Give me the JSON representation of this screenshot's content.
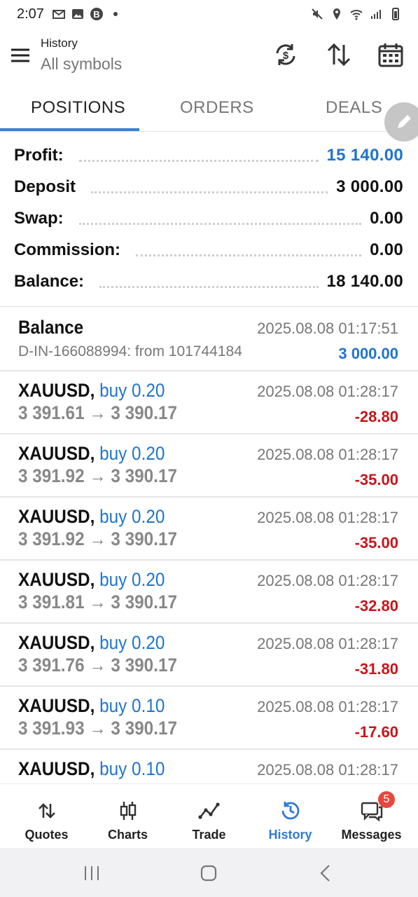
{
  "status_bar": {
    "time": "2:07"
  },
  "header": {
    "title": "History",
    "subtitle": "All symbols"
  },
  "tabs": [
    {
      "label": "POSITIONS"
    },
    {
      "label": "ORDERS"
    },
    {
      "label": "DEALS"
    }
  ],
  "summary": {
    "profit": {
      "label": "Profit:",
      "value": "15 140.00"
    },
    "deposit": {
      "label": "Deposit",
      "value": "3 000.00"
    },
    "swap": {
      "label": "Swap:",
      "value": "0.00"
    },
    "commission": {
      "label": "Commission:",
      "value": "0.00"
    },
    "balance": {
      "label": "Balance:",
      "value": "18 140.00"
    }
  },
  "balance_entry": {
    "title": "Balance",
    "time": "2025.08.08 01:17:51",
    "comment": "D-IN-166088994: from 101744184",
    "amount": "3 000.00"
  },
  "positions": [
    {
      "symbol": "XAUUSD,",
      "side": "buy 0.20",
      "prices": "3 391.61 → 3 390.17",
      "time": "2025.08.08 01:28:17",
      "profit": "-28.80"
    },
    {
      "symbol": "XAUUSD,",
      "side": "buy 0.20",
      "prices": "3 391.92 → 3 390.17",
      "time": "2025.08.08 01:28:17",
      "profit": "-35.00"
    },
    {
      "symbol": "XAUUSD,",
      "side": "buy 0.20",
      "prices": "3 391.92 → 3 390.17",
      "time": "2025.08.08 01:28:17",
      "profit": "-35.00"
    },
    {
      "symbol": "XAUUSD,",
      "side": "buy 0.20",
      "prices": "3 391.81 → 3 390.17",
      "time": "2025.08.08 01:28:17",
      "profit": "-32.80"
    },
    {
      "symbol": "XAUUSD,",
      "side": "buy 0.20",
      "prices": "3 391.76 → 3 390.17",
      "time": "2025.08.08 01:28:17",
      "profit": "-31.80"
    },
    {
      "symbol": "XAUUSD,",
      "side": "buy 0.10",
      "prices": "3 391.93 → 3 390.17",
      "time": "2025.08.08 01:28:17",
      "profit": "-17.60"
    },
    {
      "symbol": "XAUUSD,",
      "side": "buy 0.10",
      "prices": "",
      "time": "2025.08.08 01:28:17",
      "profit": ""
    }
  ],
  "bottom_nav": [
    {
      "label": "Quotes",
      "icon": "arrows-updown-icon"
    },
    {
      "label": "Charts",
      "icon": "candles-icon"
    },
    {
      "label": "Trade",
      "icon": "trend-icon"
    },
    {
      "label": "History",
      "icon": "history-clock-icon"
    },
    {
      "label": "Messages",
      "icon": "messages-icon"
    }
  ],
  "messages_badge": "5",
  "colors": {
    "accent": "#1f74cf",
    "loss": "#c8151b",
    "active_tab": "#3a80d2"
  }
}
